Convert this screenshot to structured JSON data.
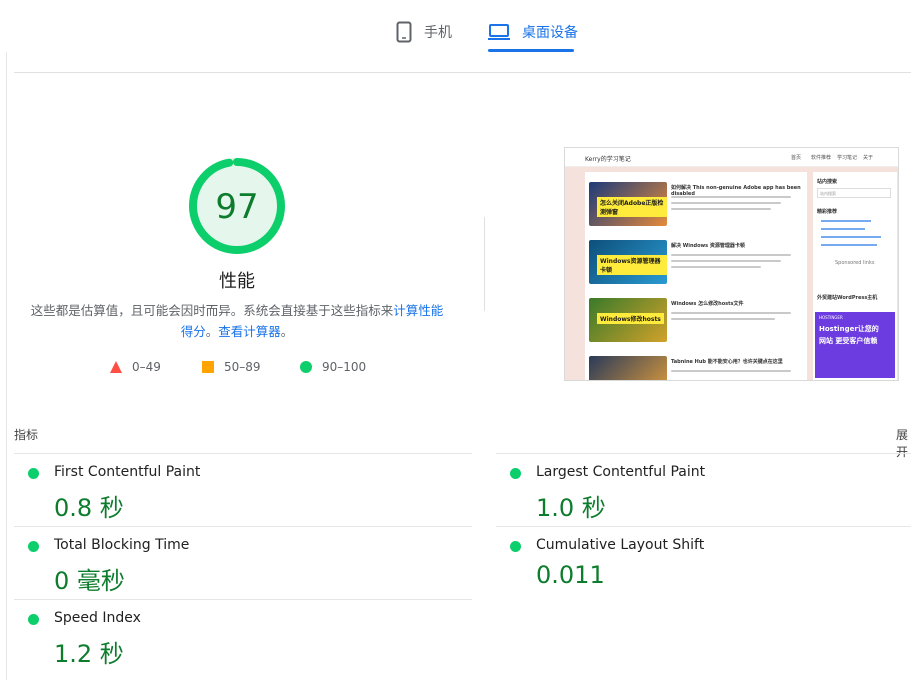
{
  "tabs": {
    "mobile_label": "手机",
    "desktop_label": "桌面设备"
  },
  "score": {
    "value": "97",
    "value_fraction": 0.97,
    "label": "性能",
    "color": "#0cce6b"
  },
  "description": {
    "text_before": "这些都是估算值，且可能会因时而异。系统会直接基于这些指标来",
    "link1": "计算性能得分",
    "text_middle": "。",
    "link2": "查看计算器",
    "text_after": "。"
  },
  "legend": [
    {
      "range": "0–49",
      "color": "#ff4e42",
      "shape": "triangle"
    },
    {
      "range": "50–89",
      "color": "#ffa400",
      "shape": "square"
    },
    {
      "range": "90–100",
      "color": "#0cce6b",
      "shape": "circle"
    }
  ],
  "preview": {
    "site_title": "Kerry的学习笔记",
    "nav": [
      "首页",
      "软件推荐",
      "学习笔记",
      "关于"
    ],
    "posts": [
      {
        "title": "如何解决 This non-genuine Adobe app has been disabled",
        "banner": "怎么关闭Adobe正版检测弹窗"
      },
      {
        "title": "解决 Windows 资源管理器卡顿",
        "banner": "Windows资源管理器卡顿"
      },
      {
        "title": "Windows 怎么修改hosts文件",
        "banner": "Windows修改hosts"
      },
      {
        "title": "Tabnine Hub 能不能安心用？也许关键点在这里",
        "banner": ""
      }
    ],
    "sidebar": {
      "search_heading": "站内搜索",
      "search_placeholder": "站内搜索",
      "recommend_heading": "精彩推荐",
      "sponsored": "Sponsored links",
      "ad_heading": "外贸建站WordPress主机",
      "ad_brand": "HOSTINGER",
      "ad_line1": "Hostinger让您的",
      "ad_line2": "网站 更受客户信赖"
    }
  },
  "metrics": {
    "header": "指标",
    "expand": "展开",
    "items": [
      {
        "name": "First Contentful Paint",
        "value": "0.8 秒",
        "status": "pass"
      },
      {
        "name": "Largest Contentful Paint",
        "value": "1.0 秒",
        "status": "pass"
      },
      {
        "name": "Total Blocking Time",
        "value": "0 毫秒",
        "status": "pass"
      },
      {
        "name": "Cumulative Layout Shift",
        "value": "0.011",
        "status": "pass"
      },
      {
        "name": "Speed Index",
        "value": "1.2 秒",
        "status": "pass"
      }
    ]
  }
}
